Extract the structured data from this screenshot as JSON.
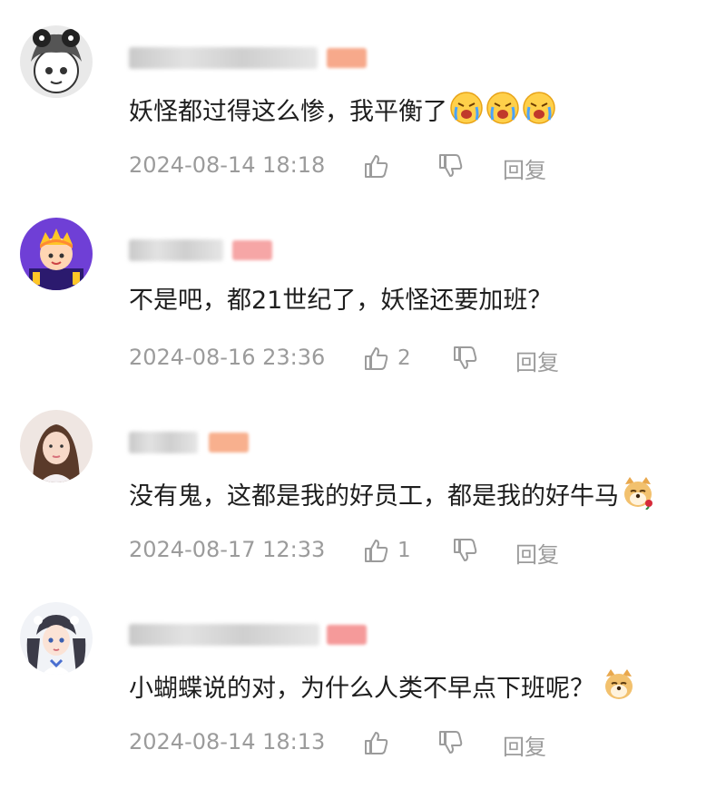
{
  "comments": [
    {
      "text": "妖怪都过得这么惨，我平衡了",
      "emoji_icons": [
        "crying-face-icon",
        "crying-face-icon",
        "crying-face-icon"
      ],
      "date": "2024-08-14 18:18",
      "likes": "",
      "reply_label": "回复",
      "avatar": "manga-girl-avatar",
      "badge_color": "#f7a98b"
    },
    {
      "text": "不是吧，都21世纪了，妖怪还要加班？",
      "emoji_icons": [],
      "date": "2024-08-16 23:36",
      "likes": "2",
      "reply_label": "回复",
      "avatar": "purple-cartoon-avatar",
      "badge_color": "#f6a6a6"
    },
    {
      "text": "没有鬼，这都是我的好员工，都是我的好牛马",
      "emoji_icons": [
        "doge-rose-icon"
      ],
      "date": "2024-08-17 12:33",
      "likes": "1",
      "reply_label": "回复",
      "avatar": "woman-photo-avatar",
      "badge_color": "#f8b08e"
    },
    {
      "text": "小蝴蝶说的对，为什么人类不早点下班呢？",
      "emoji_icons": [
        "doge-icon"
      ],
      "date": "2024-08-14 18:13",
      "likes": "",
      "reply_label": "回复",
      "avatar": "anime-girl-avatar",
      "badge_color": "#f59a9a"
    }
  ]
}
